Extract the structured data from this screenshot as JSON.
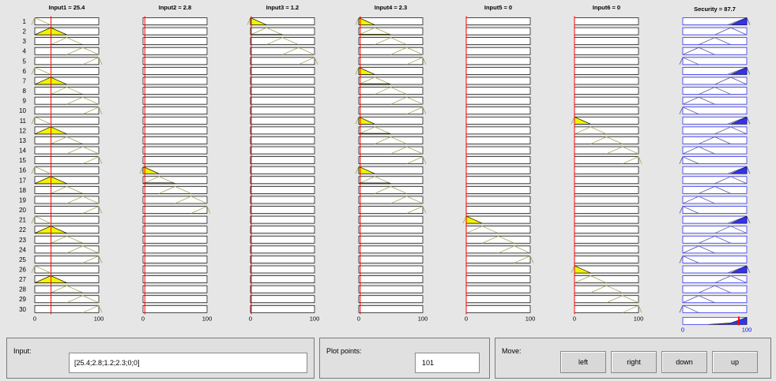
{
  "inputs": [
    {
      "title": "Input1 = 25.4",
      "value": 25.4,
      "mf_rows": [
        7,
        8,
        9,
        10,
        6,
        22,
        23,
        24,
        25,
        21,
        27,
        28,
        29,
        30,
        26
      ]
    },
    {
      "title": "Input2 = 2.8",
      "value": 2.8
    },
    {
      "title": "Input3 = 1.2",
      "value": 1.2
    },
    {
      "title": "Input4 = 2.3",
      "value": 2.3
    },
    {
      "title": "Input5 = 0",
      "value": 0
    },
    {
      "title": "Input6 = 0",
      "value": 0
    }
  ],
  "output": {
    "title": "Security = 87.7",
    "value": 87.7,
    "axis_min_label": "0",
    "axis_max_label": "100"
  },
  "axis": {
    "min_label": "0",
    "max_label": "100"
  },
  "rule_numbers": [
    "1",
    "2",
    "3",
    "4",
    "5",
    "6",
    "7",
    "8",
    "9",
    "10",
    "11",
    "12",
    "13",
    "14",
    "15",
    "16",
    "17",
    "18",
    "19",
    "20",
    "21",
    "22",
    "23",
    "24",
    "25",
    "26",
    "27",
    "28",
    "29",
    "30"
  ],
  "colors": {
    "input_fill": "#f3f300",
    "input_mf": "#a6a65c",
    "output_fill": "#3333ee",
    "output_mf": "#5555aa",
    "indicator": "#ff0000",
    "box_border": "#000000",
    "output_box_border": "#3333ee",
    "output_axis_label": "#0000ff"
  },
  "bottom": {
    "input_label": "Input:",
    "input_value": "[25.4;2.8;1.2;2.3;0;0]",
    "plot_points_label": "Plot points:",
    "plot_points_value": "101",
    "move_label": "Move:",
    "buttons": [
      "left",
      "right",
      "down",
      "up"
    ]
  }
}
